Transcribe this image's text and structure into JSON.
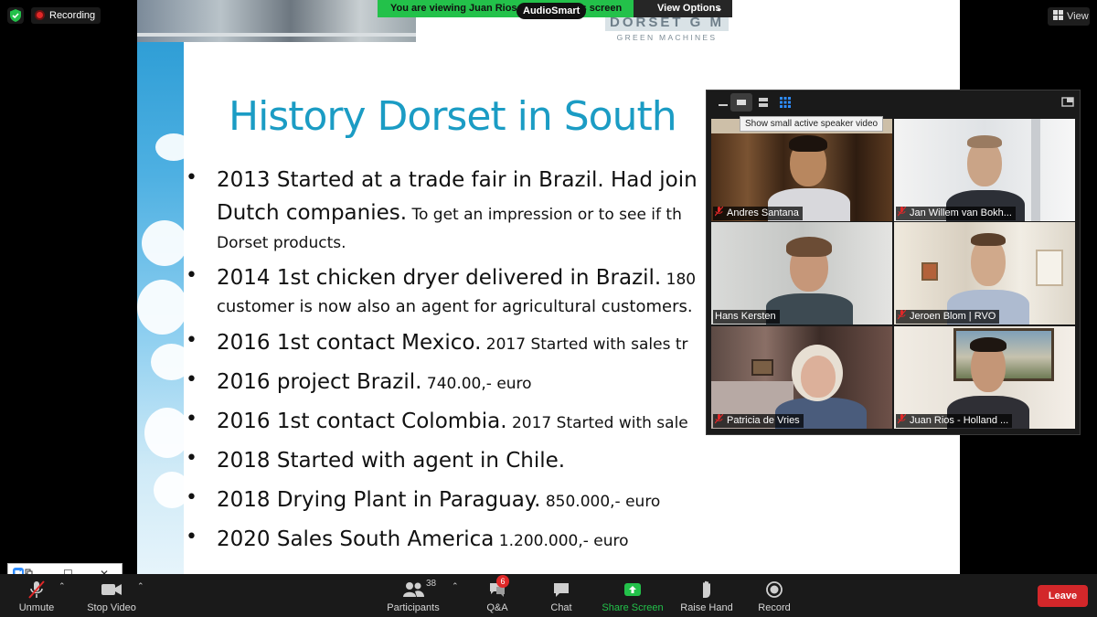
{
  "app": {
    "recording_label": "Recording",
    "viewing_banner": "You are viewing Juan Rios - ",
    "viewing_banner_tail": "'s screen",
    "audiosmart_label": "AudioSmart",
    "view_options_label": "View Options",
    "view_label": "View"
  },
  "slide": {
    "logo_title": "DORSET G M",
    "logo_subtitle": "GREEN MACHINES",
    "title": "History Dorset in South",
    "bullets": [
      {
        "main": "2013 Started at a trade fair in Brazil. Had join",
        "line2_big": "Dutch companies.",
        "line2_small": " To get an impression or to see if th",
        "line3": "Dorset products."
      },
      {
        "main": "2014 1st chicken dryer delivered in Brazil.",
        "main_small": " 180",
        "line2": "customer is now also an agent for agricultural customers."
      },
      {
        "main": "2016 1st contact Mexico.",
        "main_small": " 2017 Started with sales tr"
      },
      {
        "main": "2016  project Brazil.",
        "main_small": " 740.00,- euro"
      },
      {
        "main": "2016 1st contact Colombia.",
        "main_small": " 2017 Started with sale"
      },
      {
        "main": "2018 Started with agent in Chile."
      },
      {
        "main": "2018 Drying Plant in Paraguay.",
        "main_small": "  850.000,- euro"
      },
      {
        "main": "2020 Sales South America",
        "main_small": "  1.200.000,- euro"
      }
    ]
  },
  "video_panel": {
    "tooltip": "Show small active speaker video",
    "participants": [
      {
        "name": "Andres Santana",
        "muted": true
      },
      {
        "name": "Jan Willem van Bokh...",
        "muted": true
      },
      {
        "name": "Hans Kersten",
        "muted": false,
        "speaking": true
      },
      {
        "name": "Jeroen Blom | RVO",
        "muted": true
      },
      {
        "name": "Patricia de Vries",
        "muted": true
      },
      {
        "name": "Juan Rios - Holland ...",
        "muted": true
      }
    ]
  },
  "toolbar": {
    "unmute_label": "Unmute",
    "stop_video_label": "Stop Video",
    "participants_label": "Participants",
    "participants_count": "38",
    "qa_label": "Q&A",
    "qa_badge": "6",
    "chat_label": "Chat",
    "share_screen_label": "Share Screen",
    "raise_hand_label": "Raise Hand",
    "record_label": "Record",
    "leave_label": "Leave"
  },
  "colors": {
    "slide_title": "#1b9cc4",
    "share_green": "#23c14a",
    "leave_red": "#d3272a",
    "speaker_outline": "#c9e34a"
  }
}
